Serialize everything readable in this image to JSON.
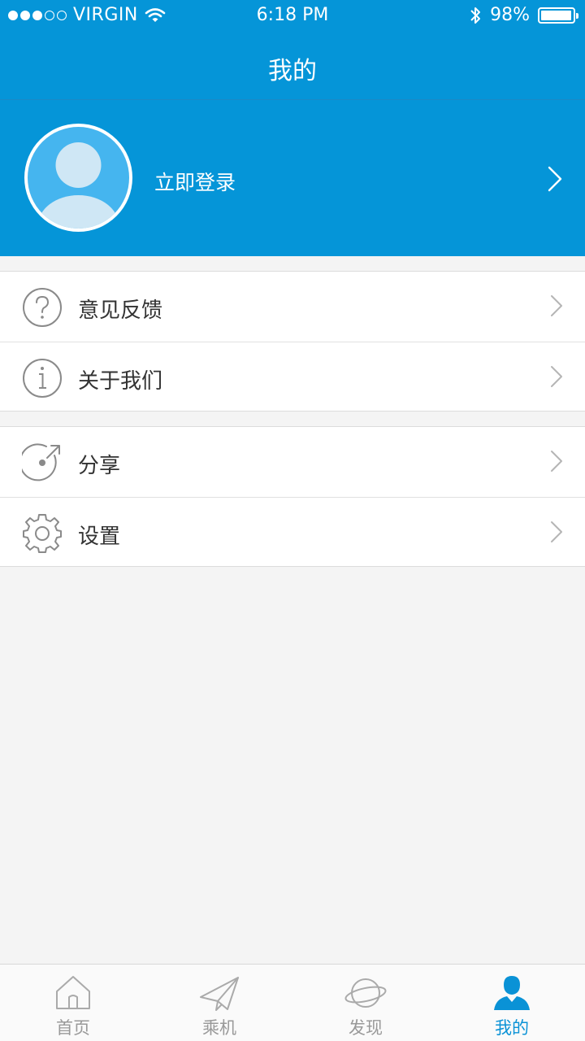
{
  "status_bar": {
    "carrier": "VIRGIN",
    "time": "6:18 PM",
    "battery_percent": "98%",
    "battery_level": 0.98,
    "signal_bars_filled": 3,
    "signal_bars_total": 5
  },
  "nav": {
    "title": "我的"
  },
  "profile": {
    "login_label": "立即登录"
  },
  "menu_groups": [
    [
      {
        "label": "意见反馈",
        "icon": "question-circle-icon"
      },
      {
        "label": "关于我们",
        "icon": "info-circle-icon"
      }
    ],
    [
      {
        "label": "分享",
        "icon": "share-icon"
      },
      {
        "label": "设置",
        "icon": "gear-icon"
      }
    ]
  ],
  "tabs": [
    {
      "label": "首页",
      "icon": "home-icon",
      "active": false
    },
    {
      "label": "乘机",
      "icon": "paper-plane-icon",
      "active": false
    },
    {
      "label": "发现",
      "icon": "planet-icon",
      "active": false
    },
    {
      "label": "我的",
      "icon": "user-icon",
      "active": true
    }
  ],
  "colors": {
    "brand_blue": "#0595d8",
    "avatar_blue": "#45b5ef",
    "tab_active": "#0a92d6",
    "tab_inactive": "#999999",
    "background": "#f4f4f4"
  }
}
